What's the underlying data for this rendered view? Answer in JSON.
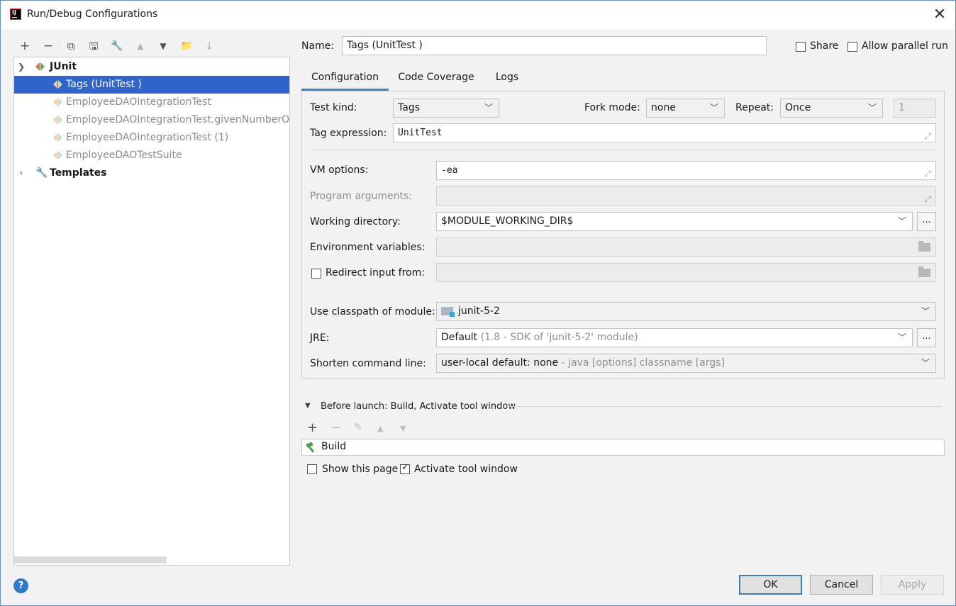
{
  "window": {
    "title": "Run/Debug Configurations",
    "app_icon": "intellij-icon",
    "close_glyph": "✕"
  },
  "toolbar": {
    "items": [
      {
        "name": "add",
        "glyph": "+"
      },
      {
        "name": "remove",
        "glyph": "−"
      },
      {
        "name": "copy",
        "glyph": "⧉"
      },
      {
        "name": "save",
        "glyph": "🖫"
      },
      {
        "name": "edit-defaults",
        "glyph": "🔧"
      },
      {
        "name": "move-up",
        "glyph": "▲"
      },
      {
        "name": "move-down",
        "glyph": "▼"
      },
      {
        "name": "new-folder",
        "glyph": "📁"
      },
      {
        "name": "sort",
        "glyph": "↓"
      }
    ]
  },
  "tree": {
    "group_label": "JUnit",
    "items": [
      {
        "label": "Tags (UnitTest )",
        "selected": true
      },
      {
        "label": "EmployeeDAOIntegrationTest",
        "selected": false
      },
      {
        "label": "EmployeeDAOIntegrationTest.givenNumberOfE",
        "selected": false
      },
      {
        "label": "EmployeeDAOIntegrationTest (1)",
        "selected": false
      },
      {
        "label": "EmployeeDAOTestSuite",
        "selected": false
      }
    ],
    "templates_label": "Templates"
  },
  "header": {
    "name_label": "Name:",
    "name_value": "Tags (UnitTest )",
    "share_label": "Share",
    "share_checked": false,
    "parallel_label": "Allow parallel run",
    "parallel_checked": false
  },
  "tabs": [
    {
      "label": "Configuration",
      "active": true
    },
    {
      "label": "Code Coverage",
      "active": false
    },
    {
      "label": "Logs",
      "active": false
    }
  ],
  "config": {
    "test_kind_label": "Test kind:",
    "test_kind_value": "Tags",
    "fork_mode_label": "Fork mode:",
    "fork_mode_value": "none",
    "repeat_label": "Repeat:",
    "repeat_value": "Once",
    "repeat_count": "1",
    "tag_expression_label": "Tag expression:",
    "tag_expression_value": "UnitTest",
    "vm_options_label": "VM options:",
    "vm_options_value": "-ea",
    "program_args_label": "Program arguments:",
    "program_args_value": "",
    "working_dir_label": "Working directory:",
    "working_dir_value": "$MODULE_WORKING_DIR$",
    "env_vars_label": "Environment variables:",
    "env_vars_value": "",
    "redirect_label": "Redirect input from:",
    "redirect_checked": false,
    "classpath_label": "Use classpath of module:",
    "classpath_value": "junit-5-2",
    "jre_label": "JRE:",
    "jre_value": "Default",
    "jre_hint": "(1.8 - SDK of 'junit-5-2' module)",
    "shorten_label": "Shorten command line:",
    "shorten_value": "user-local default: none",
    "shorten_hint": "- java [options] classname [args]",
    "browse_label": "..."
  },
  "before_launch": {
    "title": "Before launch: Build, Activate tool window",
    "items": [
      {
        "label": "Build",
        "icon": "hammer-icon"
      }
    ],
    "show_page_label": "Show this page",
    "show_page_checked": false,
    "activate_label": "Activate tool window",
    "activate_checked": true
  },
  "buttons": {
    "ok": "OK",
    "cancel": "Cancel",
    "apply": "Apply",
    "help": "?"
  },
  "colors": {
    "selection": "#2f65ca",
    "accent": "#4083c9",
    "junit_orange": "#e37233",
    "junit_green": "#59a869",
    "help_blue": "#2e79c8"
  }
}
